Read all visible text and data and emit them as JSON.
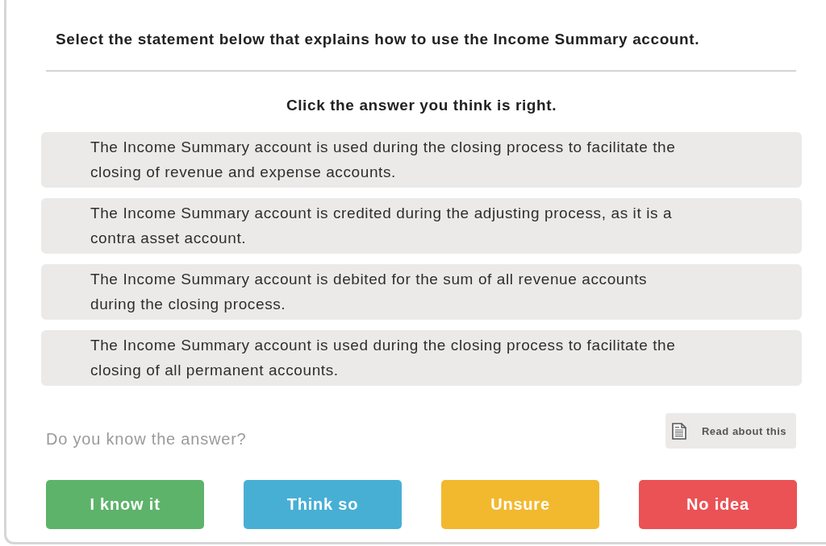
{
  "question": "Select the statement below that explains how to use the Income Summary account.",
  "instruction": "Click the answer you think is right.",
  "options": [
    {
      "text": "The Income Summary account is used during the closing process to facilitate the closing of revenue and expense accounts.",
      "selected": false
    },
    {
      "text": "The Income Summary account is credited during the adjusting process, as it is a contra asset account.",
      "selected": false
    },
    {
      "text": "The Income Summary account is debited for the sum of all revenue accounts during the closing process.",
      "selected": false
    },
    {
      "text": "The Income Summary account is used during the closing process to facilitate the closing of all permanent accounts.",
      "selected": false
    }
  ],
  "confidence_prompt": "Do you know the answer?",
  "read_button": {
    "label": "Read about this"
  },
  "confidence_buttons": [
    {
      "label": "I know it",
      "color": "#5db36a"
    },
    {
      "label": "Think so",
      "color": "#48afd4"
    },
    {
      "label": "Unsure",
      "color": "#f2b92f"
    },
    {
      "label": "No idea",
      "color": "#eb5255"
    }
  ]
}
